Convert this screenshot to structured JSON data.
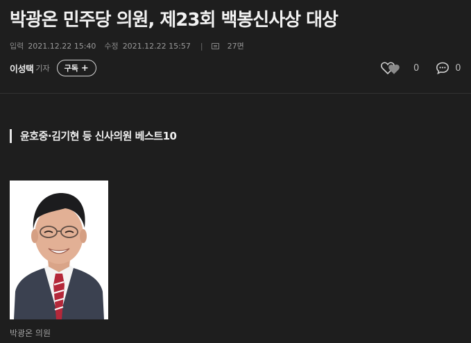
{
  "article": {
    "headline": "박광온 민주당 의원, 제23회 백봉신사상 대상",
    "meta": {
      "published_label": "입력",
      "published_value": "2021.12.22 15:40",
      "modified_label": "수정",
      "modified_value": "2021.12.22 15:57",
      "separator": "|",
      "page_info": "27면"
    },
    "author": {
      "name": "이성택",
      "role": "기자",
      "subscribe_label": "구독",
      "subscribe_plus": "+"
    },
    "reactions": {
      "likes": "0",
      "comments": "0"
    },
    "subheading": "윤호중·김기현 등 신사의원 베스트10",
    "photo": {
      "caption": "박광온 의원"
    }
  },
  "colors": {
    "background": "#1e1e1e",
    "text": "#f2f2f2",
    "muted": "#9a9a9a"
  },
  "icons": {
    "heart": "heart-icon",
    "comment": "comment-bubble-icon",
    "page": "newspaper-page-icon"
  }
}
